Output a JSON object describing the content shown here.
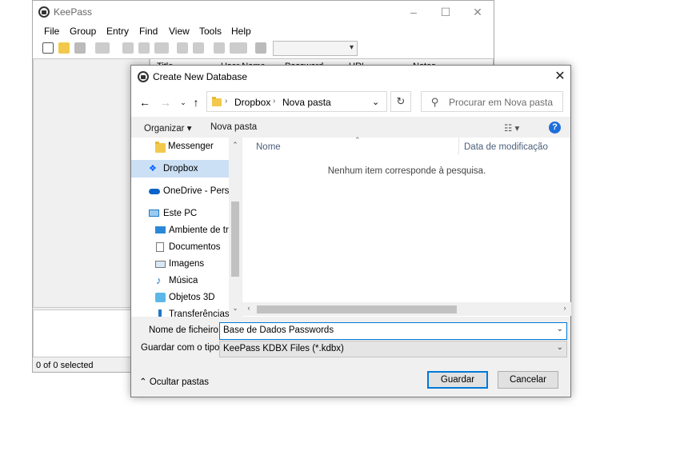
{
  "keepass": {
    "title": "KeePass",
    "menu": [
      "File",
      "Group",
      "Entry",
      "Find",
      "View",
      "Tools",
      "Help"
    ],
    "columns": [
      "Title",
      "User Name",
      "Password",
      "URL",
      "Notes"
    ],
    "status": "0 of 0 selected"
  },
  "dialog": {
    "title": "Create New Database",
    "path": [
      "Dropbox",
      "Nova pasta"
    ],
    "search_placeholder": "Procurar em Nova pasta",
    "organize_label": "Organizar",
    "new_folder_label": "Nova pasta",
    "nav_items": [
      {
        "label": "Messenger",
        "icon": "folder-icon"
      },
      {
        "label": "Dropbox",
        "icon": "dropbox-icon"
      },
      {
        "label": "OneDrive - Person",
        "icon": "onedrive-icon"
      },
      {
        "label": "Este PC",
        "icon": "pc-icon"
      },
      {
        "label": "Ambiente de tra",
        "icon": "desktop-icon"
      },
      {
        "label": "Documentos",
        "icon": "documents-icon"
      },
      {
        "label": "Imagens",
        "icon": "pictures-icon"
      },
      {
        "label": "Música",
        "icon": "music-icon"
      },
      {
        "label": "Objetos 3D",
        "icon": "objects3d-icon"
      },
      {
        "label": "Transferências",
        "icon": "downloads-icon"
      }
    ],
    "file_columns": {
      "name": "Nome",
      "modified": "Data de modificação"
    },
    "empty_message": "Nenhum item corresponde à pesquisa.",
    "filename_label": "Nome de ficheiro:",
    "filename_value": "Base de Dados Passwords",
    "filetype_label": "Guardar com o tipo:",
    "filetype_value": "KeePass KDBX Files (*.kdbx)",
    "hide_folders_label": "Ocultar pastas",
    "save_label": "Guardar",
    "cancel_label": "Cancelar"
  },
  "colors": {
    "accent": "#0078d7",
    "selection": "#cce0f5",
    "help": "#1e6fd9"
  }
}
